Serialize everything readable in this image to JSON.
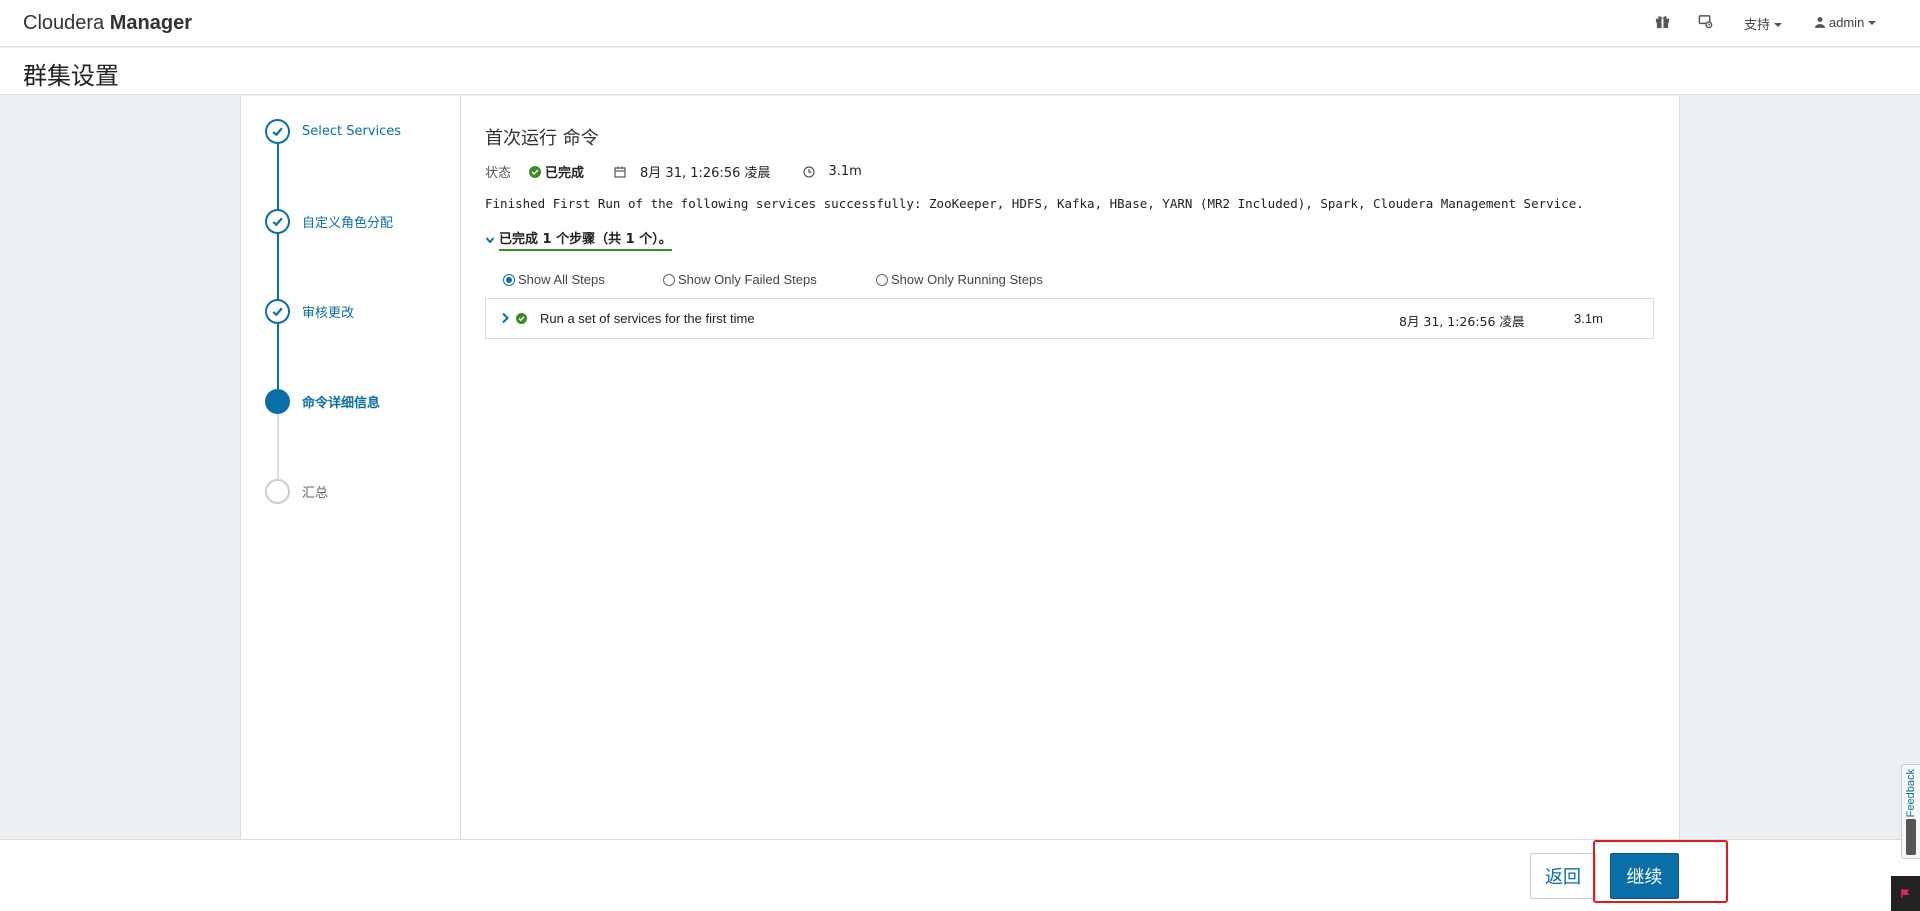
{
  "header": {
    "brand_light": "Cloudera",
    "brand_bold": "Manager",
    "support_label": "支持",
    "user_label": "admin"
  },
  "page": {
    "title": "群集设置"
  },
  "wizard_steps": [
    {
      "label": "Select Services",
      "state": "done"
    },
    {
      "label": "自定义角色分配",
      "state": "done"
    },
    {
      "label": "审核更改",
      "state": "done"
    },
    {
      "label": "命令详细信息",
      "state": "current"
    },
    {
      "label": "汇总",
      "state": "pending"
    }
  ],
  "command": {
    "title": "首次运行 命令",
    "status_label": "状态",
    "status_value": "已完成",
    "date": "8月 31, 1:26:56 凌晨",
    "duration": "3.1m",
    "message": "Finished First Run of the following services successfully: ZooKeeper, HDFS, Kafka, HBase, YARN (MR2 Included), Spark, Cloudera Management Service.",
    "summary": "已完成 1 个步骤（共 1 个）。"
  },
  "filters": [
    {
      "label": "Show All Steps",
      "checked": true
    },
    {
      "label": "Show Only Failed Steps",
      "checked": false
    },
    {
      "label": "Show Only Running Steps",
      "checked": false
    }
  ],
  "step_rows": [
    {
      "name": "Run a set of services for the first time",
      "time": "8月 31, 1:26:56 凌晨",
      "duration": "3.1m"
    }
  ],
  "footer": {
    "back_label": "返回",
    "continue_label": "继续"
  },
  "feedback": {
    "label": "Feedback"
  },
  "colors": {
    "accent": "#0a6fa7",
    "success": "#3d8c1f",
    "highlight": "#e01b1b"
  }
}
